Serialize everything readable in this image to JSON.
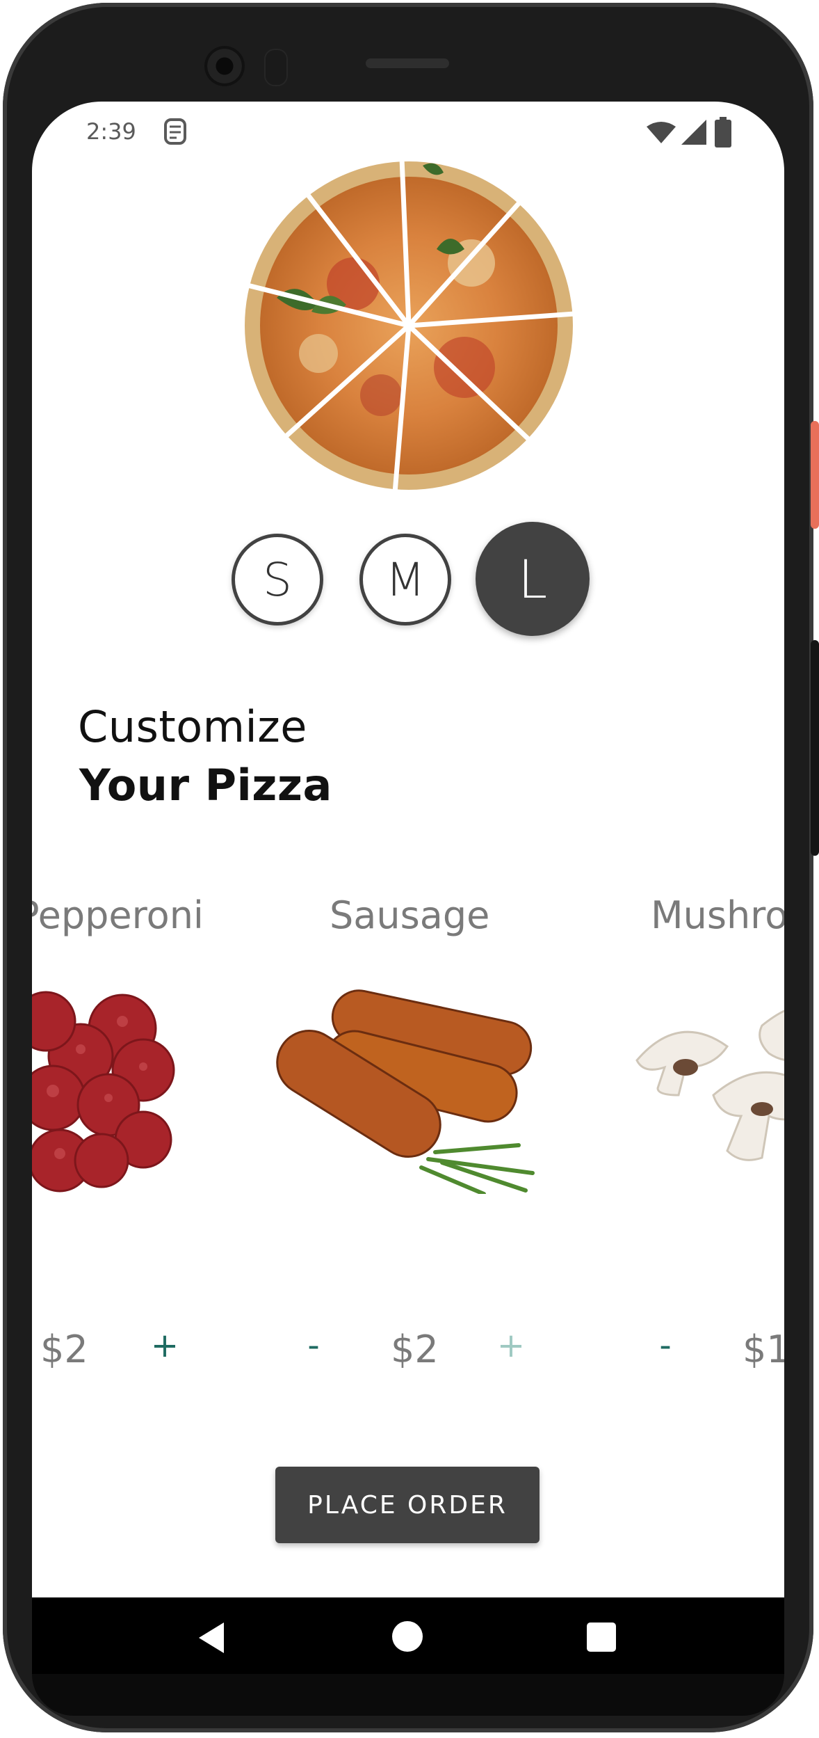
{
  "status_bar": {
    "time": "2:39"
  },
  "sizes": [
    {
      "label": "S",
      "selected": false
    },
    {
      "label": "M",
      "selected": false
    },
    {
      "label": "L",
      "selected": true
    }
  ],
  "heading": {
    "line1": "Customize",
    "line2": "Your Pizza"
  },
  "toppings": [
    {
      "name": "Pepperoni",
      "price": "$2"
    },
    {
      "name": "Sausage",
      "price": "$2"
    },
    {
      "name": "Mushroom",
      "price": "$1"
    }
  ],
  "controls": {
    "minus": "-",
    "plus": "+"
  },
  "order_button": {
    "label": "PLACE ORDER"
  },
  "colors": {
    "dark": "#424242",
    "accent": "#1f6b62",
    "accent_disabled": "#9fc9c2",
    "text_muted": "#7a7a7a"
  }
}
